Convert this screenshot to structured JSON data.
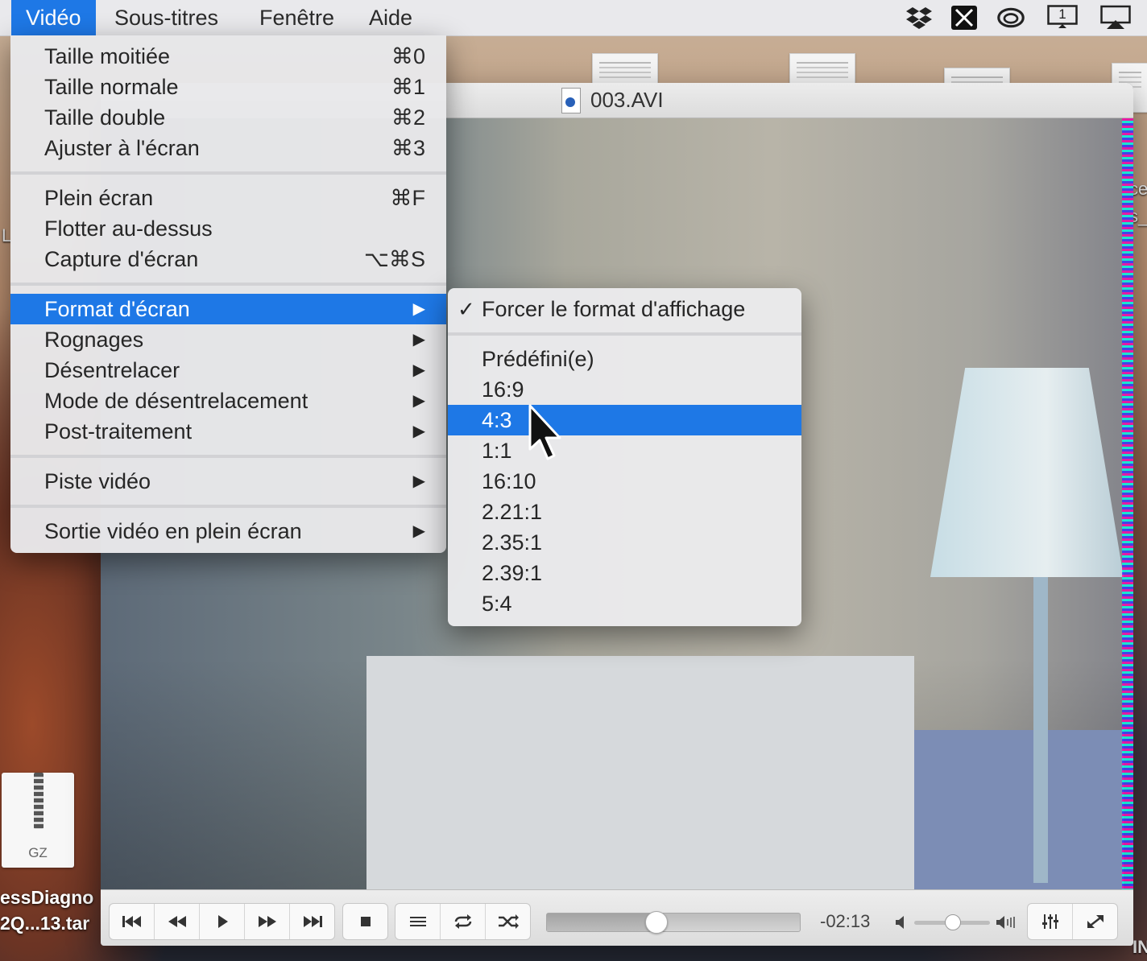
{
  "menubar": {
    "items": [
      {
        "label": "Vidéo",
        "active": true
      },
      {
        "label": "Sous-titres"
      },
      {
        "label": "Fenêtre"
      },
      {
        "label": "Aide"
      }
    ],
    "tray_icons": [
      "dropbox-icon",
      "app-x-icon",
      "creative-cloud-icon",
      "display-1-icon",
      "airplay-icon"
    ],
    "display_number": "1"
  },
  "desktop": {
    "file_ext": "GZ",
    "file_label_line1": "essDiagno",
    "file_label_line2": "2Q...13.tar",
    "edge_text_1": "ce",
    "edge_text_2": "s_",
    "edge_text_3": "L",
    "edge_text_4": "IN"
  },
  "window": {
    "title": "003.AVI",
    "time_remaining": "-02:13",
    "seek_progress": 0.43,
    "volume": 0.5
  },
  "video_menu": {
    "group1": [
      {
        "label": "Taille moitiée",
        "shortcut": "⌘0"
      },
      {
        "label": "Taille normale",
        "shortcut": "⌘1"
      },
      {
        "label": "Taille double",
        "shortcut": "⌘2"
      },
      {
        "label": "Ajuster à l'écran",
        "shortcut": "⌘3"
      }
    ],
    "group2": [
      {
        "label": "Plein écran",
        "shortcut": "⌘F"
      },
      {
        "label": "Flotter au-dessus",
        "shortcut": ""
      },
      {
        "label": "Capture d'écran",
        "shortcut": "⌥⌘S"
      }
    ],
    "group3": [
      {
        "label": "Format d'écran",
        "highlighted": true
      },
      {
        "label": "Rognages"
      },
      {
        "label": "Désentrelacer"
      },
      {
        "label": "Mode de désentrelacement"
      },
      {
        "label": "Post-traitement"
      }
    ],
    "group4": [
      {
        "label": "Piste vidéo"
      }
    ],
    "group5": [
      {
        "label": "Sortie vidéo en plein écran"
      }
    ],
    "submenu_arrow": "▶"
  },
  "aspect_submenu": {
    "force_item": {
      "label": "Forcer le format d'affichage",
      "checked": true,
      "check_mark": "✓"
    },
    "options": [
      {
        "label": "Prédéfini(e)"
      },
      {
        "label": "16:9"
      },
      {
        "label": "4:3",
        "highlighted": true
      },
      {
        "label": "1:1"
      },
      {
        "label": "16:10"
      },
      {
        "label": "2.21:1"
      },
      {
        "label": "2.35:1"
      },
      {
        "label": "2.39:1"
      },
      {
        "label": "5:4"
      }
    ]
  },
  "colors": {
    "highlight": "#1e78e6",
    "menu_bg": "#e8e8ea"
  }
}
